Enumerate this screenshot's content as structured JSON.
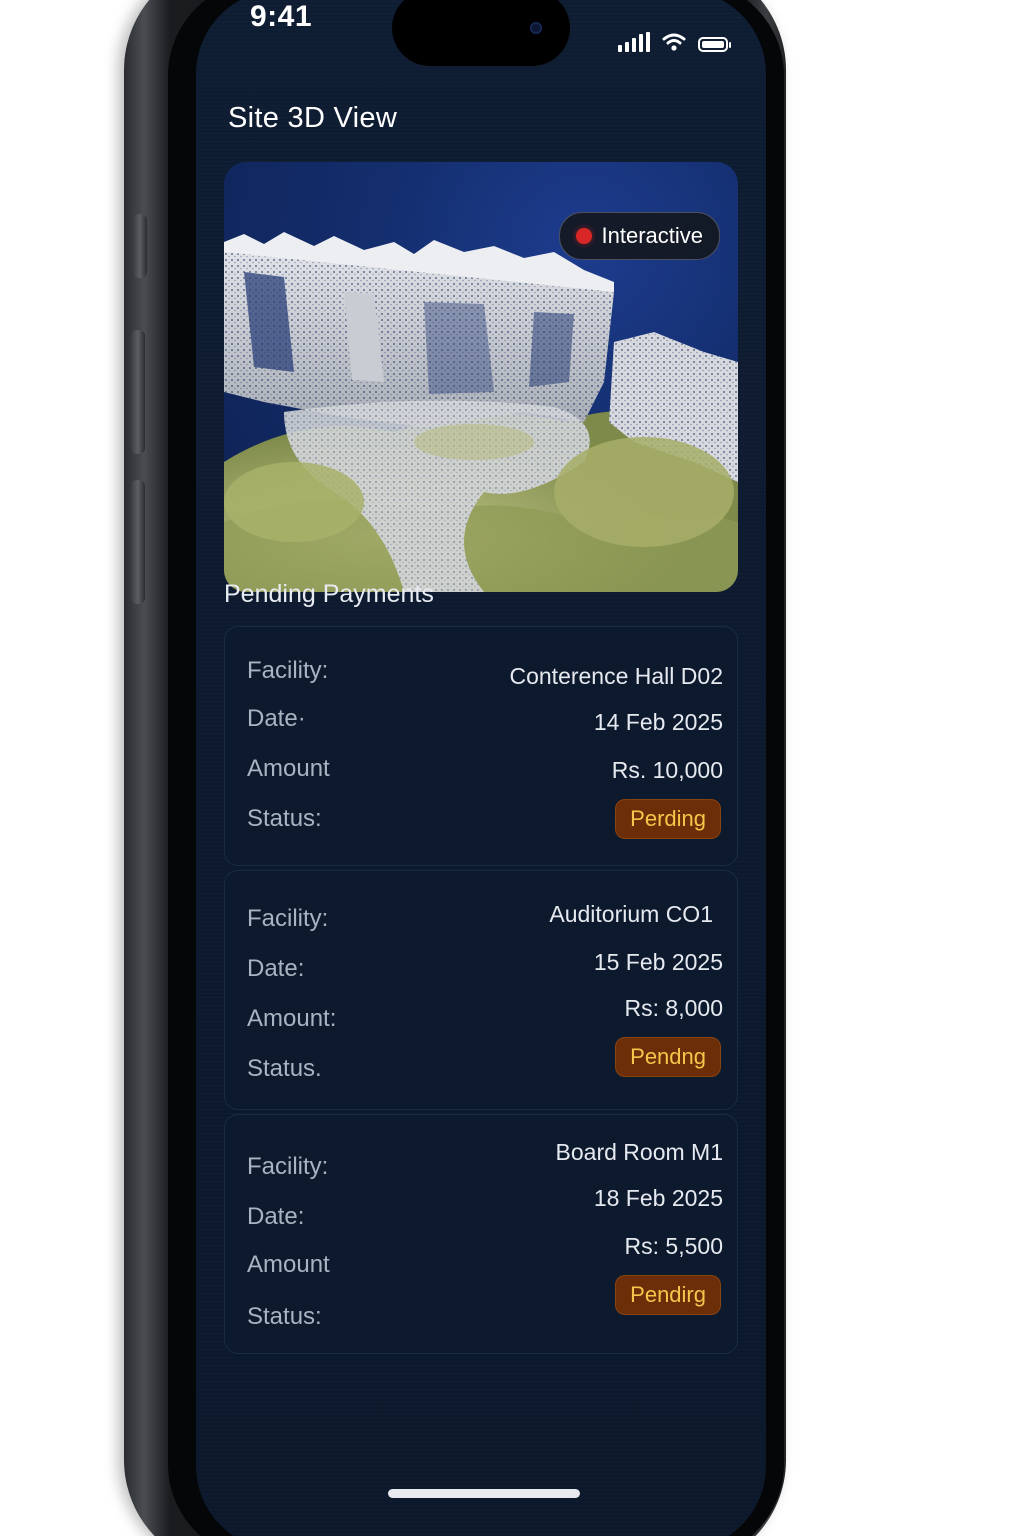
{
  "status_bar": {
    "time": "9:41"
  },
  "header": {
    "title": "Site 3D View"
  },
  "viewer": {
    "badge_label": "Interactive",
    "badge_dot_color": "#d92626"
  },
  "payments": {
    "section_title": "Pending Payments",
    "items": [
      {
        "facility_label": "Facility:",
        "facility": "Conterence Hall D02",
        "date_label": "Date·",
        "date": "14 Feb 2025",
        "amount_label": "Amount",
        "amount": "Rs. 10,000",
        "status_label": "Status:",
        "status": "Perding"
      },
      {
        "facility_label": "Facility:",
        "facility": "Auditorium CO1",
        "date_label": "Date:",
        "date": "15 Feb 2025",
        "amount_label": "Amount:",
        "amount": "Rs: 8,000",
        "status_label": "Status.",
        "status": "Pendng"
      },
      {
        "facility_label": "Facility:",
        "facility": "Board Room M1",
        "date_label": "Date:",
        "date": "18 Feb 2025",
        "amount_label": "Amount",
        "amount": "Rs: 5,500",
        "status_label": "Status:",
        "status": "Pendirg"
      }
    ]
  },
  "colors": {
    "screen_bg": "#0f1d33",
    "card_bg": "#0d1a2e",
    "status_pill_bg": "#6b2e08",
    "status_pill_text": "#f4c64a"
  }
}
